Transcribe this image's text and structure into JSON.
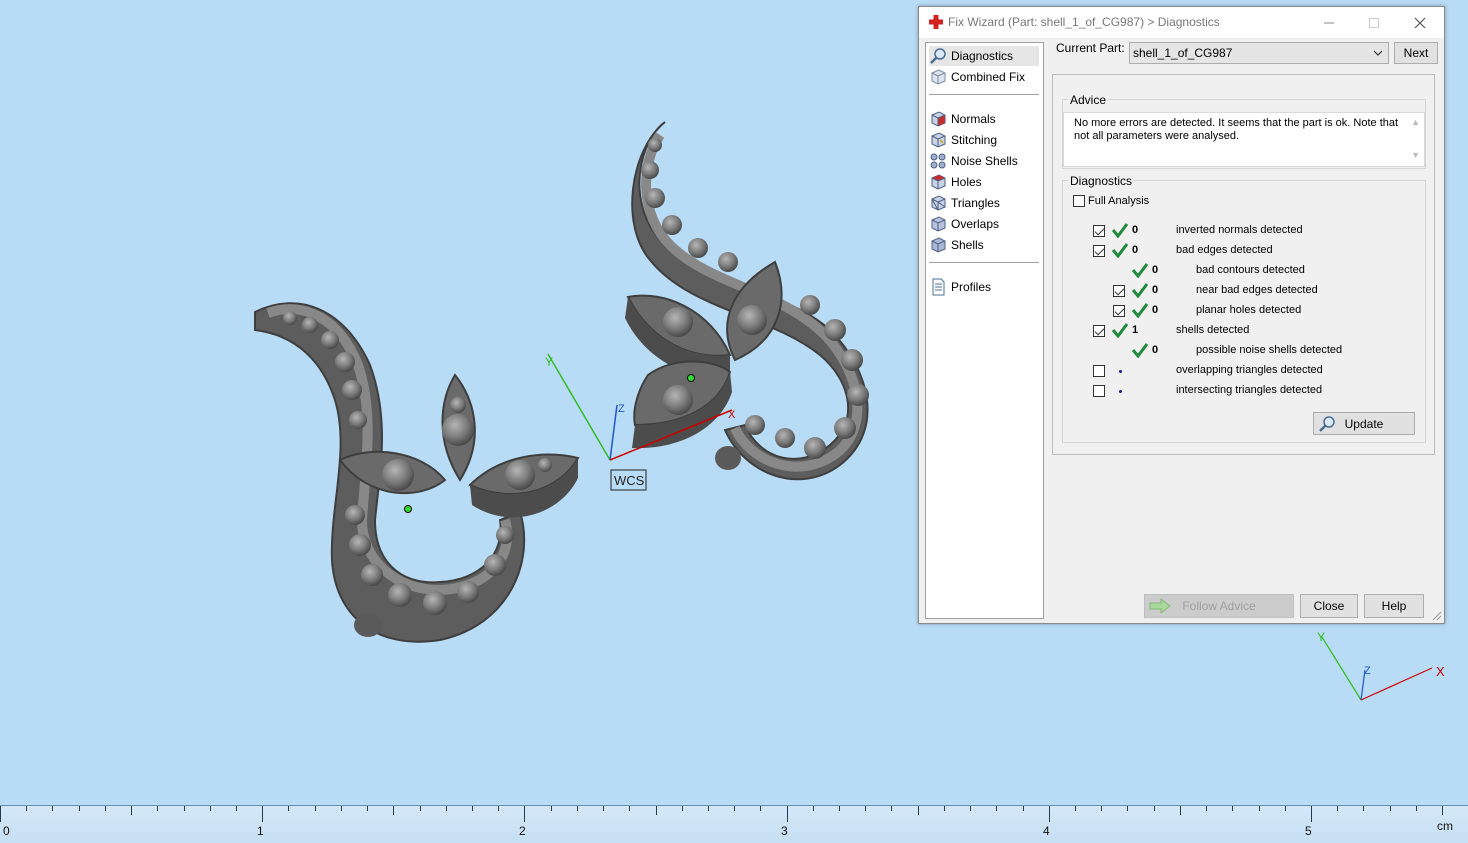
{
  "window": {
    "title": "Fix Wizard (Part: shell_1_of_CG987) > Diagnostics",
    "minimize_icon": "minimize-icon",
    "maximize_icon": "maximize-icon",
    "close_icon": "close-icon"
  },
  "nav": {
    "items": [
      {
        "label": "Diagnostics",
        "icon": "magnifier-icon",
        "selected": true
      },
      {
        "label": "Combined Fix",
        "icon": "cube-icon"
      },
      {
        "label": "Normals",
        "icon": "normals-cube-icon"
      },
      {
        "label": "Stitching",
        "icon": "stitching-cube-icon"
      },
      {
        "label": "Noise Shells",
        "icon": "noise-shells-icon"
      },
      {
        "label": "Holes",
        "icon": "holes-cube-icon"
      },
      {
        "label": "Triangles",
        "icon": "triangles-cube-icon"
      },
      {
        "label": "Overlaps",
        "icon": "overlaps-cube-icon"
      },
      {
        "label": "Shells",
        "icon": "shells-cube-icon"
      },
      {
        "label": "Profiles",
        "icon": "document-icon"
      }
    ]
  },
  "header": {
    "current_part_label": "Current Part:",
    "current_part_value": "shell_1_of_CG987",
    "next_label": "Next"
  },
  "advice": {
    "label": "Advice",
    "text": "No more errors are detected. It seems that the part is ok. Note that not all parameters were analysed."
  },
  "diagnostics": {
    "label": "Diagnostics",
    "full_analysis_label": "Full Analysis",
    "full_analysis_checked": false,
    "rows": [
      {
        "checked": true,
        "status": "ok",
        "count": "0",
        "text": "inverted normals detected"
      },
      {
        "checked": true,
        "status": "ok",
        "count": "0",
        "text": "bad edges detected"
      },
      {
        "checked": null,
        "status": "ok",
        "count": "0",
        "text": "bad contours detected"
      },
      {
        "checked": true,
        "status": "ok",
        "count": "0",
        "text": "near bad edges detected"
      },
      {
        "checked": true,
        "status": "ok",
        "count": "0",
        "text": "planar holes detected"
      },
      {
        "checked": true,
        "status": "ok",
        "count": "1",
        "text": "shells detected"
      },
      {
        "checked": null,
        "status": "ok",
        "count": "0",
        "text": "possible noise shells detected"
      },
      {
        "checked": false,
        "status": "unknown",
        "count": "",
        "text": "overlapping triangles detected"
      },
      {
        "checked": false,
        "status": "unknown",
        "count": "",
        "text": "intersecting triangles detected"
      }
    ],
    "update_label": "Update"
  },
  "footer": {
    "follow_advice_label": "Follow Advice",
    "close_label": "Close",
    "help_label": "Help"
  },
  "viewport": {
    "wcs_label": "WCS",
    "axis_x": "X",
    "axis_y": "Y",
    "axis_z": "Z",
    "ruler_labels": [
      "0",
      "1",
      "2",
      "3",
      "4",
      "5"
    ],
    "ruler_unit": "cm"
  },
  "colors": {
    "background": "#b9dcf6",
    "model": "#6e6e6e",
    "axis_x": "#cc0000",
    "axis_y": "#33bb22",
    "axis_z": "#2255cc",
    "ok_check": "#1e8a3a"
  }
}
